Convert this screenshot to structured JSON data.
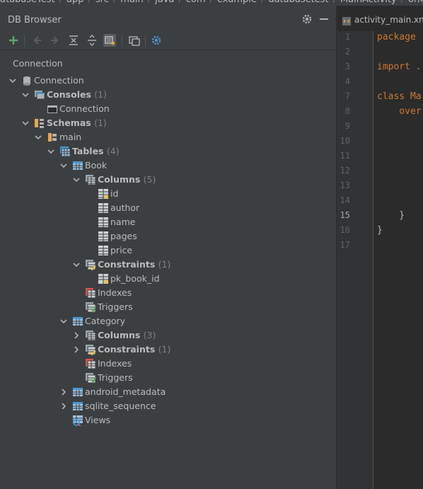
{
  "breadcrumb": [
    "DatabaseTest",
    "app",
    "src",
    "main",
    "java",
    "com",
    "example",
    "databasetest",
    "MainActivity",
    "onCre"
  ],
  "panel": {
    "title": "DB Browser",
    "tab": "Connection"
  },
  "toolbar": {
    "icons": [
      "add-icon",
      "back-icon",
      "forward-icon",
      "collapse-all-icon",
      "expand-all-icon",
      "filter-icon",
      "open-console-icon",
      "settings-icon"
    ]
  },
  "tree": [
    {
      "label": "Connection",
      "count": "",
      "bold": false,
      "icon": "database-icon",
      "arrow": "down"
    },
    {
      "label": "Consoles",
      "count": "(1)",
      "bold": true,
      "icon": "consoles-icon",
      "arrow": "down"
    },
    {
      "label": "Connection",
      "count": "",
      "bold": false,
      "icon": "console-icon",
      "arrow": ""
    },
    {
      "label": "Schemas",
      "count": "(1)",
      "bold": true,
      "icon": "schemas-icon",
      "arrow": "down"
    },
    {
      "label": "main",
      "count": "",
      "bold": false,
      "icon": "schema-icon",
      "arrow": "down"
    },
    {
      "label": "Tables",
      "count": "(4)",
      "bold": true,
      "icon": "tables-icon",
      "arrow": "down"
    },
    {
      "label": "Book",
      "count": "",
      "bold": false,
      "icon": "table-icon",
      "arrow": "down"
    },
    {
      "label": "Columns",
      "count": "(5)",
      "bold": true,
      "icon": "columns-icon",
      "arrow": "down"
    },
    {
      "label": "id",
      "count": "",
      "bold": false,
      "icon": "column-pk-icon",
      "arrow": ""
    },
    {
      "label": "author",
      "count": "",
      "bold": false,
      "icon": "column-icon",
      "arrow": ""
    },
    {
      "label": "name",
      "count": "",
      "bold": false,
      "icon": "column-icon",
      "arrow": ""
    },
    {
      "label": "pages",
      "count": "",
      "bold": false,
      "icon": "column-icon",
      "arrow": ""
    },
    {
      "label": "price",
      "count": "",
      "bold": false,
      "icon": "column-icon",
      "arrow": ""
    },
    {
      "label": "Constraints",
      "count": "(1)",
      "bold": true,
      "icon": "constraints-icon",
      "arrow": "down"
    },
    {
      "label": "pk_book_id",
      "count": "",
      "bold": false,
      "icon": "constraint-icon",
      "arrow": ""
    },
    {
      "label": "Indexes",
      "count": "",
      "bold": false,
      "icon": "indexes-icon",
      "arrow": ""
    },
    {
      "label": "Triggers",
      "count": "",
      "bold": false,
      "icon": "triggers-icon",
      "arrow": ""
    },
    {
      "label": "Category",
      "count": "",
      "bold": false,
      "icon": "table-icon",
      "arrow": "down"
    },
    {
      "label": "Columns",
      "count": "(3)",
      "bold": true,
      "icon": "columns-icon",
      "arrow": "right"
    },
    {
      "label": "Constraints",
      "count": "(1)",
      "bold": true,
      "icon": "constraints-icon",
      "arrow": "right"
    },
    {
      "label": "Indexes",
      "count": "",
      "bold": false,
      "icon": "indexes-icon",
      "arrow": ""
    },
    {
      "label": "Triggers",
      "count": "",
      "bold": false,
      "icon": "triggers-icon",
      "arrow": ""
    },
    {
      "label": "android_metadata",
      "count": "",
      "bold": false,
      "icon": "table-icon",
      "arrow": "right"
    },
    {
      "label": "sqlite_sequence",
      "count": "",
      "bold": false,
      "icon": "table-icon",
      "arrow": "right"
    },
    {
      "label": "Views",
      "count": "",
      "bold": false,
      "icon": "views-icon",
      "arrow": ""
    }
  ],
  "editor": {
    "tab_label": "activity_main.xml",
    "current_line": "15",
    "lines": [
      {
        "n": "1",
        "text": "package"
      },
      {
        "n": "2",
        "text": ""
      },
      {
        "n": "3",
        "text": "import ."
      },
      {
        "n": "4",
        "text": ""
      },
      {
        "n": "7",
        "text": "class Ma"
      },
      {
        "n": "8",
        "text": "    over"
      },
      {
        "n": "9",
        "text": ""
      },
      {
        "n": "10",
        "text": ""
      },
      {
        "n": "11",
        "text": ""
      },
      {
        "n": "12",
        "text": ""
      },
      {
        "n": "13",
        "text": ""
      },
      {
        "n": "14",
        "text": ""
      },
      {
        "n": "15",
        "text": "    }"
      },
      {
        "n": "16",
        "text": "}"
      },
      {
        "n": "17",
        "text": ""
      }
    ]
  }
}
